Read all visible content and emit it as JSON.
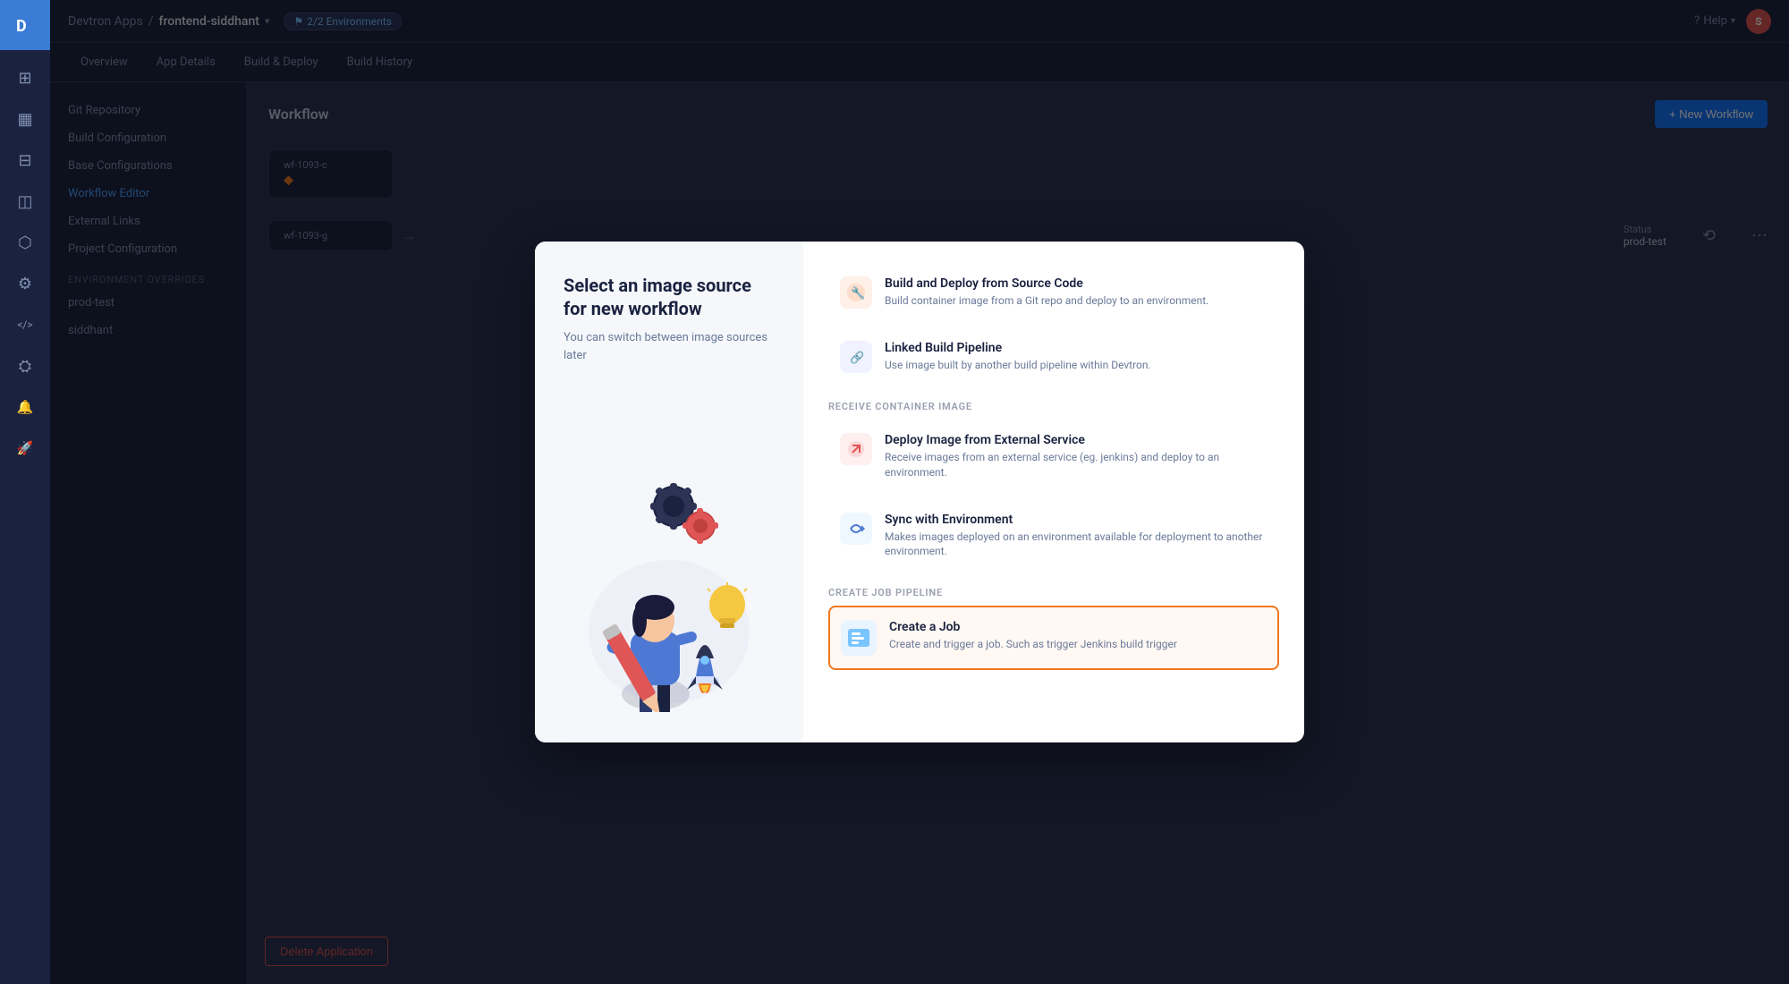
{
  "sidebar": {
    "logo_text": "D",
    "icons": [
      {
        "name": "apps-icon",
        "symbol": "⊞",
        "active": false
      },
      {
        "name": "dashboard-icon",
        "symbol": "▦",
        "active": false
      },
      {
        "name": "grid-icon",
        "symbol": "⊟",
        "active": false
      },
      {
        "name": "layers-icon",
        "symbol": "◫",
        "active": false
      },
      {
        "name": "shield-icon",
        "symbol": "⬡",
        "active": false
      },
      {
        "name": "settings-icon",
        "symbol": "⚙",
        "active": false
      },
      {
        "name": "code-icon",
        "symbol": "</>",
        "active": false
      },
      {
        "name": "config2-icon",
        "symbol": "⛭",
        "active": false
      },
      {
        "name": "notify-icon",
        "symbol": "🔔",
        "active": false
      },
      {
        "name": "deploy-icon",
        "symbol": "🚀",
        "active": false
      }
    ]
  },
  "topbar": {
    "breadcrumb_app": "Devtron Apps",
    "separator": "/",
    "breadcrumb_current": "frontend-siddhant",
    "env_badge": "2/2 Environments",
    "help_label": "Help",
    "avatar_initials": "S"
  },
  "nav_tabs": {
    "tabs": [
      {
        "label": "Overview",
        "active": false
      },
      {
        "label": "App Details",
        "active": false
      },
      {
        "label": "Build & Deploy",
        "active": false
      },
      {
        "label": "Build History",
        "active": false
      }
    ]
  },
  "side_nav": {
    "items": [
      {
        "label": "Git Repository",
        "active": false
      },
      {
        "label": "Build Configuration",
        "active": false
      },
      {
        "label": "Base Configurations",
        "active": false
      },
      {
        "label": "Workflow Editor",
        "active": true
      }
    ],
    "sections": [
      {
        "label": "ENVIRONMENT OVERRIDES",
        "items": [
          {
            "label": "prod-test",
            "active": false
          },
          {
            "label": "siddhant",
            "active": false
          }
        ]
      }
    ],
    "external_links_label": "External Links",
    "project_config_label": "Project Configuration"
  },
  "workflow_area": {
    "title": "Workflow",
    "new_workflow_btn": "+ New Workflow",
    "nodes_row1": {
      "id": "wf-1093-c",
      "icon": "⬥"
    },
    "nodes_row2": {
      "id": "wf-1093-g",
      "status_label": "Status",
      "status_value": "prod-test"
    }
  },
  "delete_btn": "Delete Application",
  "modal": {
    "title": "Select an image source for new workflow",
    "subtitle": "You can switch between image sources later",
    "section1_label": "",
    "options": [
      {
        "id": "build-deploy",
        "icon": "🔧",
        "icon_bg": "#fff0e8",
        "title": "Build and Deploy from Source Code",
        "desc": "Build container image from a Git repo and deploy to an environment.",
        "selected": false
      },
      {
        "id": "linked-pipeline",
        "icon": "🔗",
        "icon_bg": "#f0f4ff",
        "title": "Linked Build Pipeline",
        "desc": "Use image built by another build pipeline within Devtron.",
        "selected": false
      }
    ],
    "section2_label": "RECEIVE CONTAINER IMAGE",
    "options2": [
      {
        "id": "deploy-external",
        "icon": "↗",
        "icon_bg": "#fdf0f0",
        "title": "Deploy Image from External Service",
        "desc": "Receive images from an external service (eg. jenkins) and deploy to an environment.",
        "selected": false
      },
      {
        "id": "sync-env",
        "icon": "⟲",
        "icon_bg": "#f0f8ff",
        "title": "Sync with Environment",
        "desc": "Makes images deployed on an environment available for deployment to another environment.",
        "selected": false
      }
    ],
    "section3_label": "CREATE JOB PIPELINE",
    "options3": [
      {
        "id": "create-job",
        "icon": "💼",
        "icon_bg": "#e8f4ff",
        "title": "Create a Job",
        "desc": "Create and trigger a job. Such as trigger Jenkins build trigger",
        "selected": true
      }
    ]
  }
}
